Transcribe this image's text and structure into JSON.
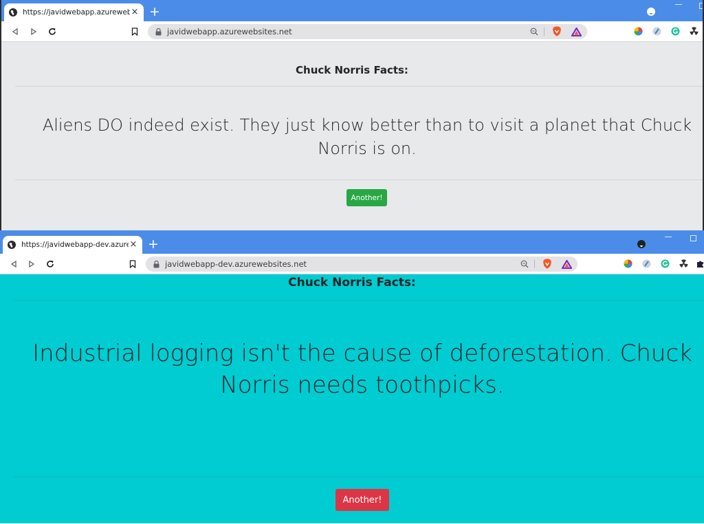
{
  "windows": [
    {
      "tab_title": "https://javidwebapp.azurewebsites",
      "url": "javidwebapp.azurewebsites.net",
      "page": {
        "heading": "Chuck Norris Facts:",
        "fact_line1": "Aliens DO indeed exist. They just know better than to visit a planet that Chuck",
        "fact_line2": "Norris is on.",
        "button_label": "Another!",
        "background_color": "#e8e9eb",
        "button_color": "#28a745"
      }
    },
    {
      "tab_title": "https://javidwebapp-dev.azurewe",
      "url": "javidwebapp-dev.azurewebsites.net",
      "page": {
        "heading": "Chuck Norris Facts:",
        "fact_line1": "Industrial logging isn't the cause of deforestation. Chuck",
        "fact_line2": "Norris needs toothpicks.",
        "button_label": "Another!",
        "background_color": "#00ccd1",
        "button_color": "#dc3545"
      }
    }
  ],
  "icons": {
    "tab_favicon": "globe-icon",
    "tab_close": "×",
    "new_tab": "+",
    "back": "back-arrow-icon",
    "forward": "forward-arrow-icon",
    "reload": "reload-icon",
    "bookmark": "bookmark-icon",
    "lock": "lock-icon",
    "zoom": "zoom-icon",
    "brave_shield": "brave-lion-icon",
    "brave_rewards": "triangle-rewards-icon"
  },
  "colors": {
    "tabbar": "#4b8ce8",
    "omnibox": "#e3e3e6"
  }
}
